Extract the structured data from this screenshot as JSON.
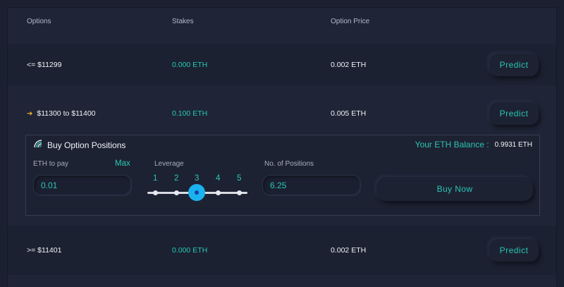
{
  "table": {
    "headers": {
      "options": "Options",
      "stakes": "Stakes",
      "option_price": "Option Price"
    },
    "rows": [
      {
        "option": "<= $11299",
        "stake": "0.000 ETH",
        "price": "0.002 ETH",
        "predict_label": "Predict",
        "selected": false
      },
      {
        "option": "$11300 to $11400",
        "stake": "0.100 ETH",
        "price": "0.005 ETH",
        "predict_label": "Predict",
        "selected": true
      },
      {
        "option": ">= $11401",
        "stake": "0.000 ETH",
        "price": "0.002 ETH",
        "predict_label": "Predict",
        "selected": false
      }
    ]
  },
  "buy_panel": {
    "title": "Buy Option Positions",
    "balance_label": "Your ETH Balance :",
    "balance_value": "0.9931 ETH",
    "eth_to_pay_label": "ETH to pay",
    "max_label": "Max",
    "eth_to_pay_value": "0.01",
    "leverage_label": "Leverage",
    "leverage_options": [
      "1",
      "2",
      "3",
      "4",
      "5"
    ],
    "leverage_selected": "3",
    "positions_label": "No. of Positions",
    "positions_value": "6.25",
    "buy_label": "Buy Now"
  },
  "colors": {
    "accent": "#29c6b3",
    "knob": "#1ab3f0",
    "arrow": "#f0b429",
    "background": "#1b2031"
  },
  "icons": {
    "selected_row": "arrow-right-icon",
    "buy_panel": "rainbow-icon"
  }
}
